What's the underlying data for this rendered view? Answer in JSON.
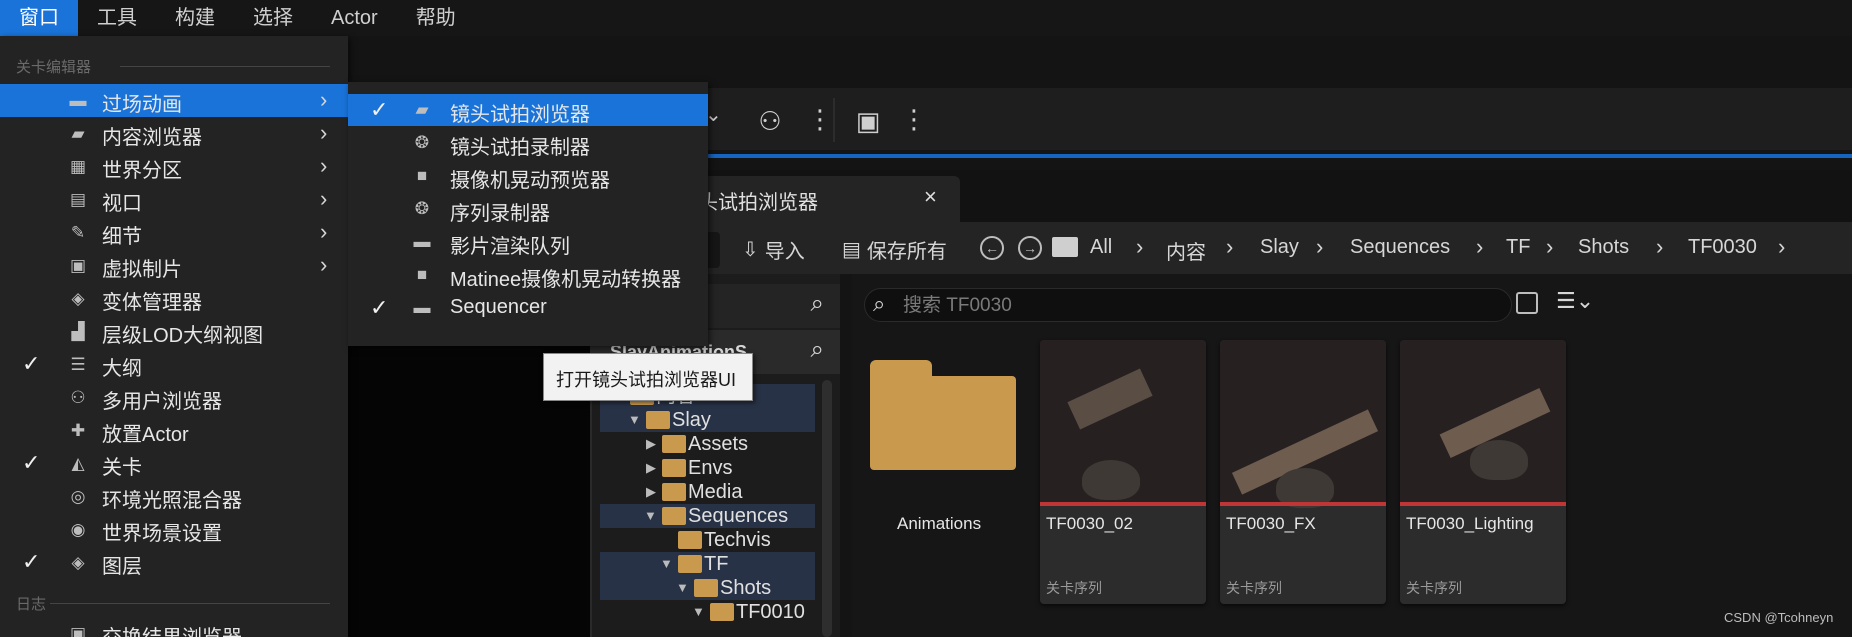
{
  "menubar": {
    "items": [
      "窗口",
      "工具",
      "构建",
      "选择",
      "Actor",
      "帮助"
    ]
  },
  "window_menu": {
    "section_level_editor": "关卡编辑器",
    "section_log": "日志",
    "items": [
      {
        "label": "过场动画",
        "icon": "clapperboard-icon",
        "checked": false,
        "submenu": true,
        "highlighted": true
      },
      {
        "label": "内容浏览器",
        "icon": "folder-search-icon",
        "checked": false,
        "submenu": true
      },
      {
        "label": "世界分区",
        "icon": "grid-icon",
        "checked": false,
        "submenu": true
      },
      {
        "label": "视口",
        "icon": "viewport-icon",
        "checked": false,
        "submenu": true
      },
      {
        "label": "细节",
        "icon": "pencil-icon",
        "checked": false,
        "submenu": true
      },
      {
        "label": "虚拟制片",
        "icon": "production-icon",
        "checked": false,
        "submenu": true
      },
      {
        "label": "变体管理器",
        "icon": "layers-icon",
        "checked": false,
        "submenu": false
      },
      {
        "label": "层级LOD大纲视图",
        "icon": "lod-icon",
        "checked": false,
        "submenu": false
      },
      {
        "label": "大纲",
        "icon": "outline-icon",
        "checked": true,
        "submenu": false
      },
      {
        "label": "多用户浏览器",
        "icon": "users-icon",
        "checked": false,
        "submenu": false
      },
      {
        "label": "放置Actor",
        "icon": "place-actor-icon",
        "checked": false,
        "submenu": false
      },
      {
        "label": "关卡",
        "icon": "level-icon",
        "checked": true,
        "submenu": false
      },
      {
        "label": "环境光照混合器",
        "icon": "env-light-icon",
        "checked": false,
        "submenu": false
      },
      {
        "label": "世界场景设置",
        "icon": "globe-icon",
        "checked": false,
        "submenu": false
      },
      {
        "label": "图层",
        "icon": "layers-icon",
        "checked": true,
        "submenu": false
      }
    ],
    "log_item": "交换结果浏览器"
  },
  "submenu": {
    "items": [
      {
        "label": "镜头试拍浏览器",
        "icon": "shot-browser-icon",
        "checked": true,
        "highlighted": true
      },
      {
        "label": "镜头试拍录制器",
        "icon": "film-reel-icon",
        "checked": false
      },
      {
        "label": "摄像机晃动预览器",
        "icon": "camera-icon",
        "checked": false
      },
      {
        "label": "序列录制器",
        "icon": "film-reel-icon",
        "checked": false
      },
      {
        "label": "影片渲染队列",
        "icon": "clapperboard-icon",
        "checked": false
      },
      {
        "label": "Matinee摄像机晃动转换器",
        "icon": "camera-icon",
        "checked": false
      },
      {
        "label": "Sequencer",
        "icon": "clapperboard-icon",
        "checked": true
      }
    ]
  },
  "tooltip": "打开镜头试拍浏览器UI",
  "tab": {
    "label": "头试拍浏览器",
    "close": "×"
  },
  "pathbar": {
    "import_label": "导入",
    "save_all_label": "保存所有",
    "crumbs": [
      "All",
      "内容",
      "Slay",
      "Sequences",
      "TF",
      "Shots",
      "TF0030"
    ]
  },
  "left_panel": {
    "header": "SlayAnimationS",
    "tree": [
      {
        "label": "内容",
        "indent": 1,
        "expanded": true,
        "selected": true
      },
      {
        "label": "Slay",
        "indent": 2,
        "expanded": true,
        "selected": true
      },
      {
        "label": "Assets",
        "indent": 3,
        "expanded": false,
        "selected": false
      },
      {
        "label": "Envs",
        "indent": 3,
        "expanded": false,
        "selected": false
      },
      {
        "label": "Media",
        "indent": 3,
        "expanded": false,
        "selected": false
      },
      {
        "label": "Sequences",
        "indent": 3,
        "expanded": true,
        "selected": true
      },
      {
        "label": "Techvis",
        "indent": 4,
        "expanded": null,
        "selected": false
      },
      {
        "label": "TF",
        "indent": 4,
        "expanded": true,
        "selected": true
      },
      {
        "label": "Shots",
        "indent": 5,
        "expanded": true,
        "selected": true
      },
      {
        "label": "TF0010",
        "indent": 6,
        "expanded": true,
        "selected": false
      }
    ]
  },
  "search": {
    "placeholder": "搜索 TF0030"
  },
  "assets": {
    "folder": {
      "label": "Animations"
    },
    "cards": [
      {
        "name": "TF0030_02",
        "type": "关卡序列"
      },
      {
        "name": "TF0030_FX",
        "type": "关卡序列"
      },
      {
        "name": "TF0030_Lighting",
        "type": "关卡序列"
      }
    ]
  },
  "watermark": "CSDN @Tcohneyn",
  "colors": {
    "accent": "#1a73d9",
    "folder": "#c99a4e",
    "card_stripe": "#c03535"
  }
}
